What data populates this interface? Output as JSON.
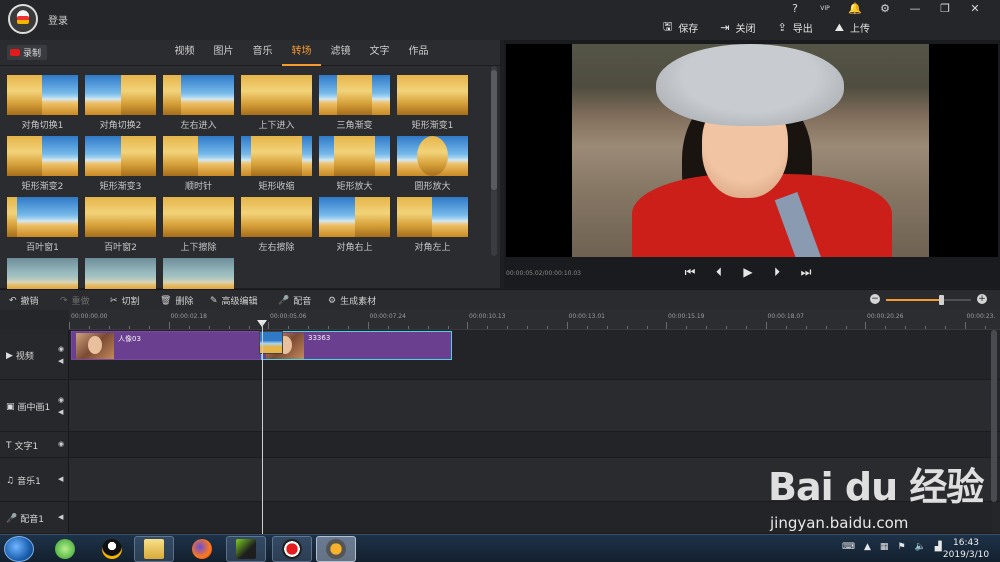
{
  "app": {
    "login_label": "登录",
    "window_icons": [
      "?",
      "VIP",
      "🔔",
      "⚙",
      "—",
      "❐",
      "✕"
    ],
    "actions": [
      {
        "icon": "save-icon",
        "glyph": "🖫",
        "label": "保存"
      },
      {
        "icon": "exit-icon",
        "glyph": "⇥",
        "label": "关闭"
      },
      {
        "icon": "export-icon",
        "glyph": "⇪",
        "label": "导出"
      },
      {
        "icon": "upload-icon",
        "glyph": "⛰",
        "label": "上传"
      }
    ]
  },
  "library": {
    "record_label": "录制",
    "tabs": [
      {
        "label": "视频",
        "active": false
      },
      {
        "label": "图片",
        "active": false
      },
      {
        "label": "音乐",
        "active": false
      },
      {
        "label": "转场",
        "active": true
      },
      {
        "label": "滤镜",
        "active": false
      },
      {
        "label": "文字",
        "active": false
      },
      {
        "label": "作品",
        "active": false
      }
    ],
    "transitions": [
      "对角切换1",
      "对角切换2",
      "左右进入",
      "上下进入",
      "三角渐变",
      "矩形渐变1",
      "矩形渐变2",
      "矩形渐变3",
      "顺时针",
      "矩形收缩",
      "矩形放大",
      "圆形放大",
      "百叶窗1",
      "百叶窗2",
      "上下擦除",
      "左右擦除",
      "对角右上",
      "对角左上",
      "",
      "",
      ""
    ]
  },
  "preview": {
    "timecode": "00:00:05.02/00:00:10.03",
    "controls": [
      {
        "name": "skip-start-icon",
        "glyph": "⏮"
      },
      {
        "name": "step-back-icon",
        "glyph": "⏴"
      },
      {
        "name": "play-icon",
        "glyph": "▶"
      },
      {
        "name": "step-forward-icon",
        "glyph": "⏵"
      },
      {
        "name": "skip-end-icon",
        "glyph": "⏭"
      }
    ]
  },
  "toolbar": {
    "tools": [
      {
        "name": "undo",
        "icon": "undo-icon",
        "glyph": "↶",
        "label": "撤销",
        "enabled": true
      },
      {
        "name": "redo",
        "icon": "redo-icon",
        "glyph": "↷",
        "label": "重做",
        "enabled": false
      },
      {
        "name": "cut",
        "icon": "scissors-icon",
        "glyph": "✂",
        "label": "切割",
        "enabled": true
      },
      {
        "name": "delete",
        "icon": "trash-icon",
        "glyph": "🗑",
        "label": "删除",
        "enabled": true
      },
      {
        "name": "advanced-edit",
        "icon": "pencil-icon",
        "glyph": "✎",
        "label": "高级编辑",
        "enabled": true
      },
      {
        "name": "dub",
        "icon": "microphone-icon",
        "glyph": "🎤",
        "label": "配音",
        "enabled": true
      },
      {
        "name": "generate",
        "icon": "gear-icon",
        "glyph": "⚙",
        "label": "生成素材",
        "enabled": true
      }
    ],
    "zoom_level": 0.65
  },
  "timeline": {
    "ruler": [
      "00:00:00.00",
      "00:00:02.18",
      "00:00:05.06",
      "00:00:07.24",
      "00:00:10.13",
      "00:00:13.01",
      "00:00:15.19",
      "00:00:18.07",
      "00:00:20.26",
      "00:00:23."
    ],
    "tracks": [
      {
        "name": "视频",
        "icon": "video-icon",
        "glyph": "▶"
      },
      {
        "name": "画中画1",
        "icon": "picture-in-picture-icon",
        "glyph": "▣"
      },
      {
        "name": "文字1",
        "icon": "text-icon",
        "glyph": "T"
      },
      {
        "name": "音乐1",
        "icon": "music-icon",
        "glyph": "♫"
      },
      {
        "name": "配音1",
        "icon": "microphone-icon",
        "glyph": "🎤"
      }
    ],
    "clips": [
      {
        "label": "人像03"
      },
      {
        "label": "33363"
      }
    ]
  },
  "taskbar": {
    "time": "16:43",
    "date": "2019/3/10"
  },
  "watermark": {
    "brand": "Bai du 经验",
    "url": "jingyan.baidu.com"
  }
}
